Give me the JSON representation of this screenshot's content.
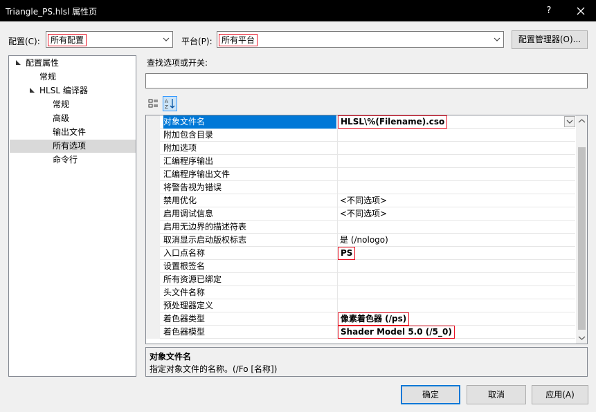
{
  "window": {
    "title": "Triangle_PS.hlsl 属性页",
    "help_label": "?"
  },
  "config": {
    "config_label": "配置(C):",
    "config_value": "所有配置",
    "platform_label": "平台(P):",
    "platform_value": "所有平台",
    "manager_button": "配置管理器(O)..."
  },
  "tree": {
    "items": [
      {
        "label": "配置属性"
      },
      {
        "label": "常规"
      },
      {
        "label": "HLSL 编译器"
      },
      {
        "label": "常规"
      },
      {
        "label": "高级"
      },
      {
        "label": "输出文件"
      },
      {
        "label": "所有选项"
      },
      {
        "label": "命令行"
      }
    ]
  },
  "search": {
    "label": "查找选项或开关:",
    "value": ""
  },
  "properties": [
    {
      "name": "对象文件名",
      "value": "HLSL\\%(Filename).cso"
    },
    {
      "name": "附加包含目录",
      "value": ""
    },
    {
      "name": "附加选项",
      "value": ""
    },
    {
      "name": "汇编程序输出",
      "value": ""
    },
    {
      "name": "汇编程序输出文件",
      "value": ""
    },
    {
      "name": "将警告视为错误",
      "value": ""
    },
    {
      "name": "禁用优化",
      "value": "<不同选项>"
    },
    {
      "name": "启用调试信息",
      "value": "<不同选项>"
    },
    {
      "name": "启用无边界的描述符表",
      "value": ""
    },
    {
      "name": "取消显示启动版权标志",
      "value": "是 (/nologo)"
    },
    {
      "name": "入口点名称",
      "value": "PS"
    },
    {
      "name": "设置根签名",
      "value": ""
    },
    {
      "name": "所有资源已绑定",
      "value": ""
    },
    {
      "name": "头文件名称",
      "value": ""
    },
    {
      "name": "预处理器定义",
      "value": ""
    },
    {
      "name": "着色器类型",
      "value": "像素着色器 (/ps)"
    },
    {
      "name": "着色器模型",
      "value": "Shader Model 5.0 (/5_0)"
    }
  ],
  "description": {
    "title": "对象文件名",
    "text": "指定对象文件的名称。(/Fo [名称])"
  },
  "buttons": {
    "ok": "确定",
    "cancel": "取消",
    "apply": "应用(A)"
  },
  "colors": {
    "selection": "#0078d7",
    "highlight_border": "#e81123",
    "title_bar": "#000000"
  }
}
